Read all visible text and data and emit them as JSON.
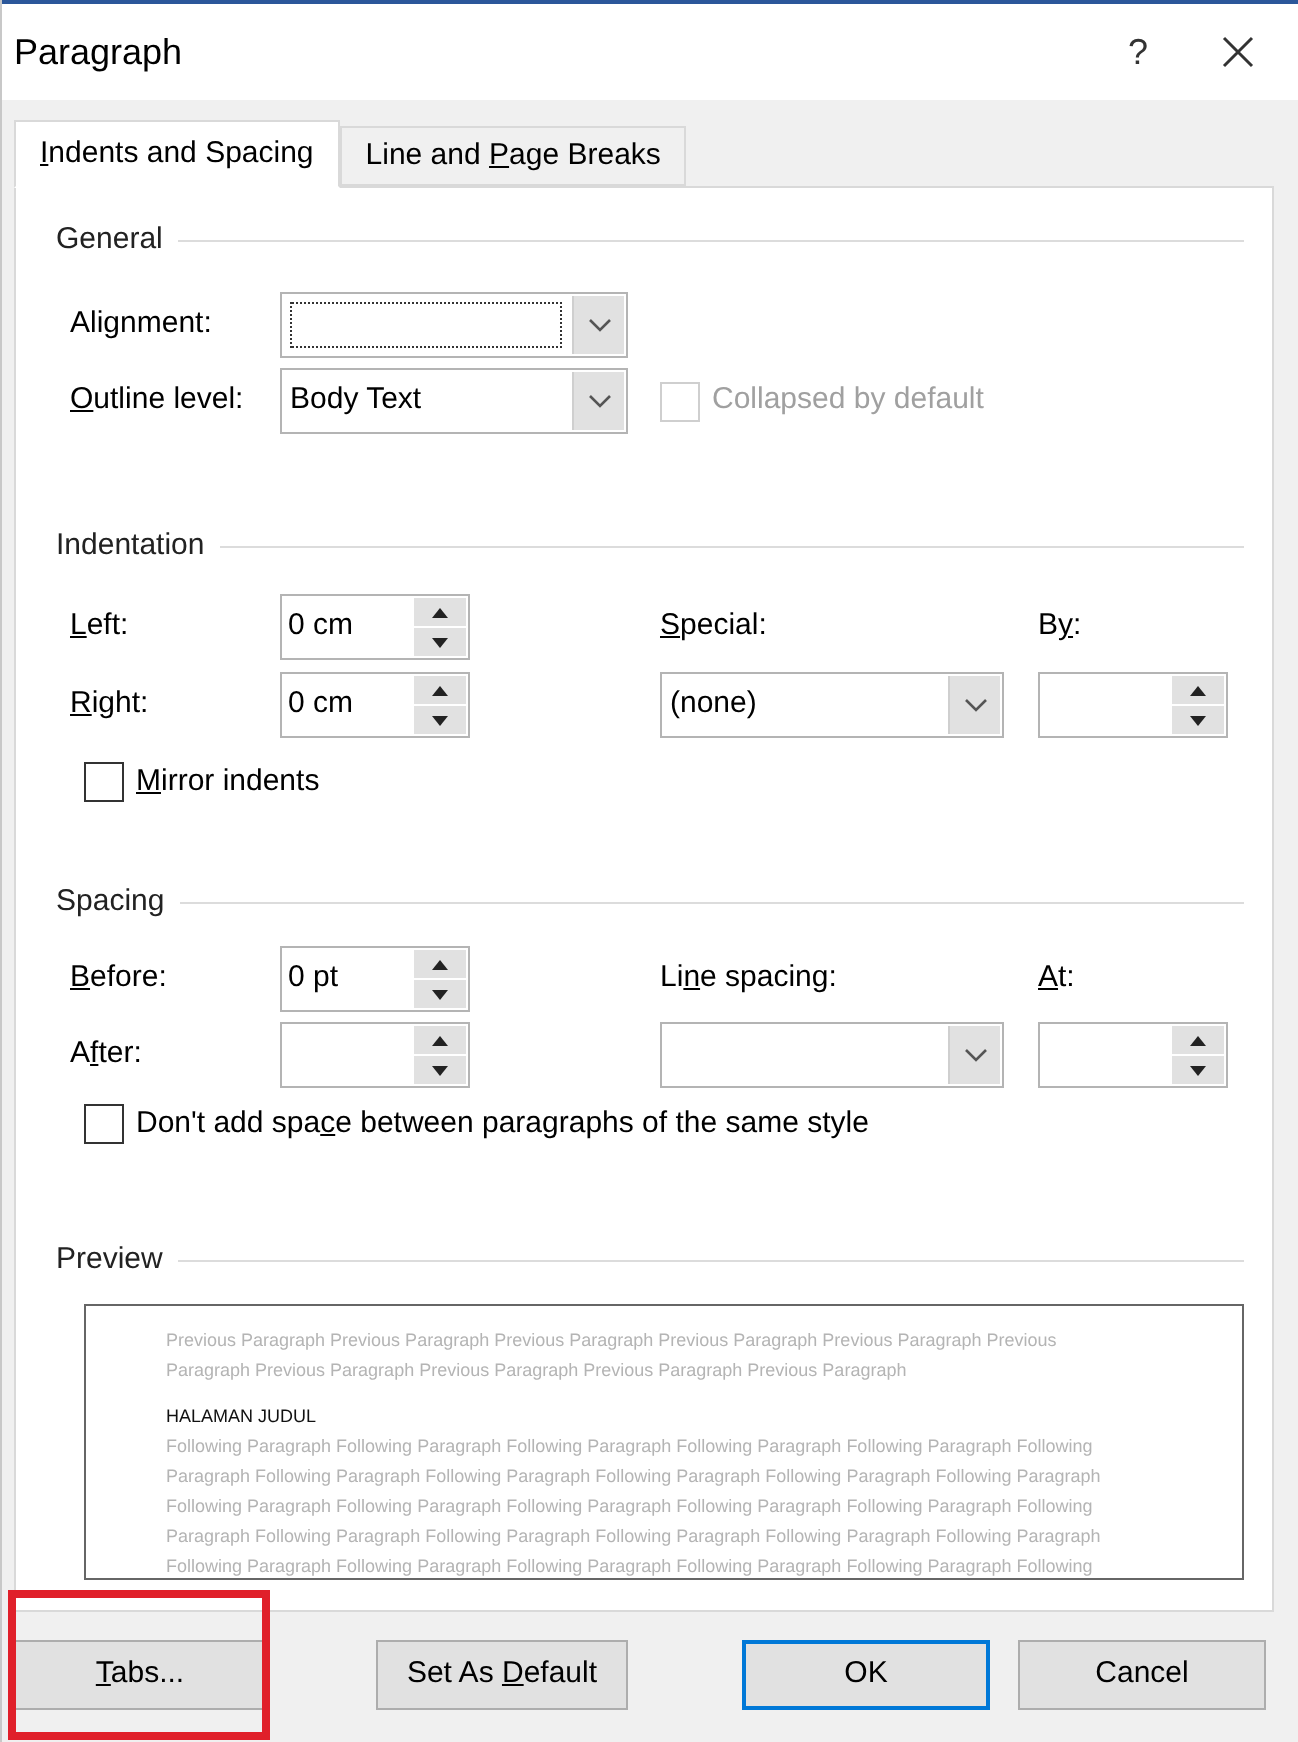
{
  "window": {
    "title": "Paragraph",
    "help": "?"
  },
  "tabs": [
    {
      "label": {
        "key": "I",
        "post": "ndents and Spacing"
      },
      "selected": true
    },
    {
      "label": {
        "pre": "Line and ",
        "key": "P",
        "post": "age Breaks"
      },
      "selected": false
    }
  ],
  "general": {
    "heading": "General",
    "alignment": {
      "label": {
        "pre": "Alignment:"
      },
      "focused": true
    },
    "outline_level": {
      "label": {
        "key": "O",
        "post": "utline level:"
      },
      "value": "Body Text"
    },
    "collapsed": {
      "label": {
        "pre": "Collapsed by default"
      },
      "checked": false,
      "disabled": true
    }
  },
  "indentation": {
    "heading": "Indentation",
    "left": {
      "label": {
        "key": "L",
        "post": "eft:"
      },
      "value": "0 cm"
    },
    "right": {
      "label": {
        "key": "R",
        "post": "ight:"
      },
      "value": "0 cm"
    },
    "special": {
      "label": {
        "key": "S",
        "post": "pecial:"
      },
      "value": "(none)"
    },
    "by": {
      "label": {
        "pre": "B",
        "key": "y",
        "post": ":"
      }
    },
    "mirror": {
      "label": {
        "key": "M",
        "post": "irror indents"
      },
      "checked": false,
      "disabled": false
    }
  },
  "spacing": {
    "heading": "Spacing",
    "before": {
      "label": {
        "key": "B",
        "post": "efore:"
      },
      "value": "0 pt"
    },
    "after": {
      "label": {
        "pre": "A",
        "key": "f",
        "post": "ter:"
      }
    },
    "line_spacing": {
      "label": {
        "pre": "Li",
        "key": "n",
        "post": "e spacing:"
      }
    },
    "at": {
      "label": {
        "key": "A",
        "post": "t:"
      }
    },
    "dont_add": {
      "label": {
        "pre": "Don't add spa",
        "key": "c",
        "post": "e between paragraphs of the same style"
      },
      "checked": false,
      "disabled": false
    }
  },
  "preview": {
    "heading": "Preview",
    "previous_lines": [
      "Previous Paragraph Previous Paragraph Previous Paragraph Previous Paragraph Previous Paragraph Previous",
      "Paragraph Previous Paragraph Previous Paragraph Previous Paragraph Previous Paragraph"
    ],
    "sample": "HALAMAN JUDUL",
    "following_lines": [
      "Following Paragraph Following Paragraph Following Paragraph Following Paragraph Following Paragraph Following",
      "Paragraph Following Paragraph Following Paragraph Following Paragraph Following Paragraph Following Paragraph",
      "Following Paragraph Following Paragraph Following Paragraph Following Paragraph Following Paragraph Following",
      "Paragraph Following Paragraph Following Paragraph Following Paragraph Following Paragraph Following Paragraph",
      "Following Paragraph Following Paragraph Following Paragraph Following Paragraph Following Paragraph Following"
    ]
  },
  "buttons": [
    {
      "label": {
        "key": "T",
        "post": "abs..."
      },
      "default": false,
      "highlighted": true
    },
    {
      "label": {
        "pre": "Set As ",
        "key": "D",
        "post": "efault"
      },
      "default": false,
      "highlighted": false
    },
    {
      "label": {
        "pre": "OK"
      },
      "default": true,
      "highlighted": false
    },
    {
      "label": {
        "pre": "Cancel"
      },
      "default": false,
      "highlighted": false
    }
  ]
}
